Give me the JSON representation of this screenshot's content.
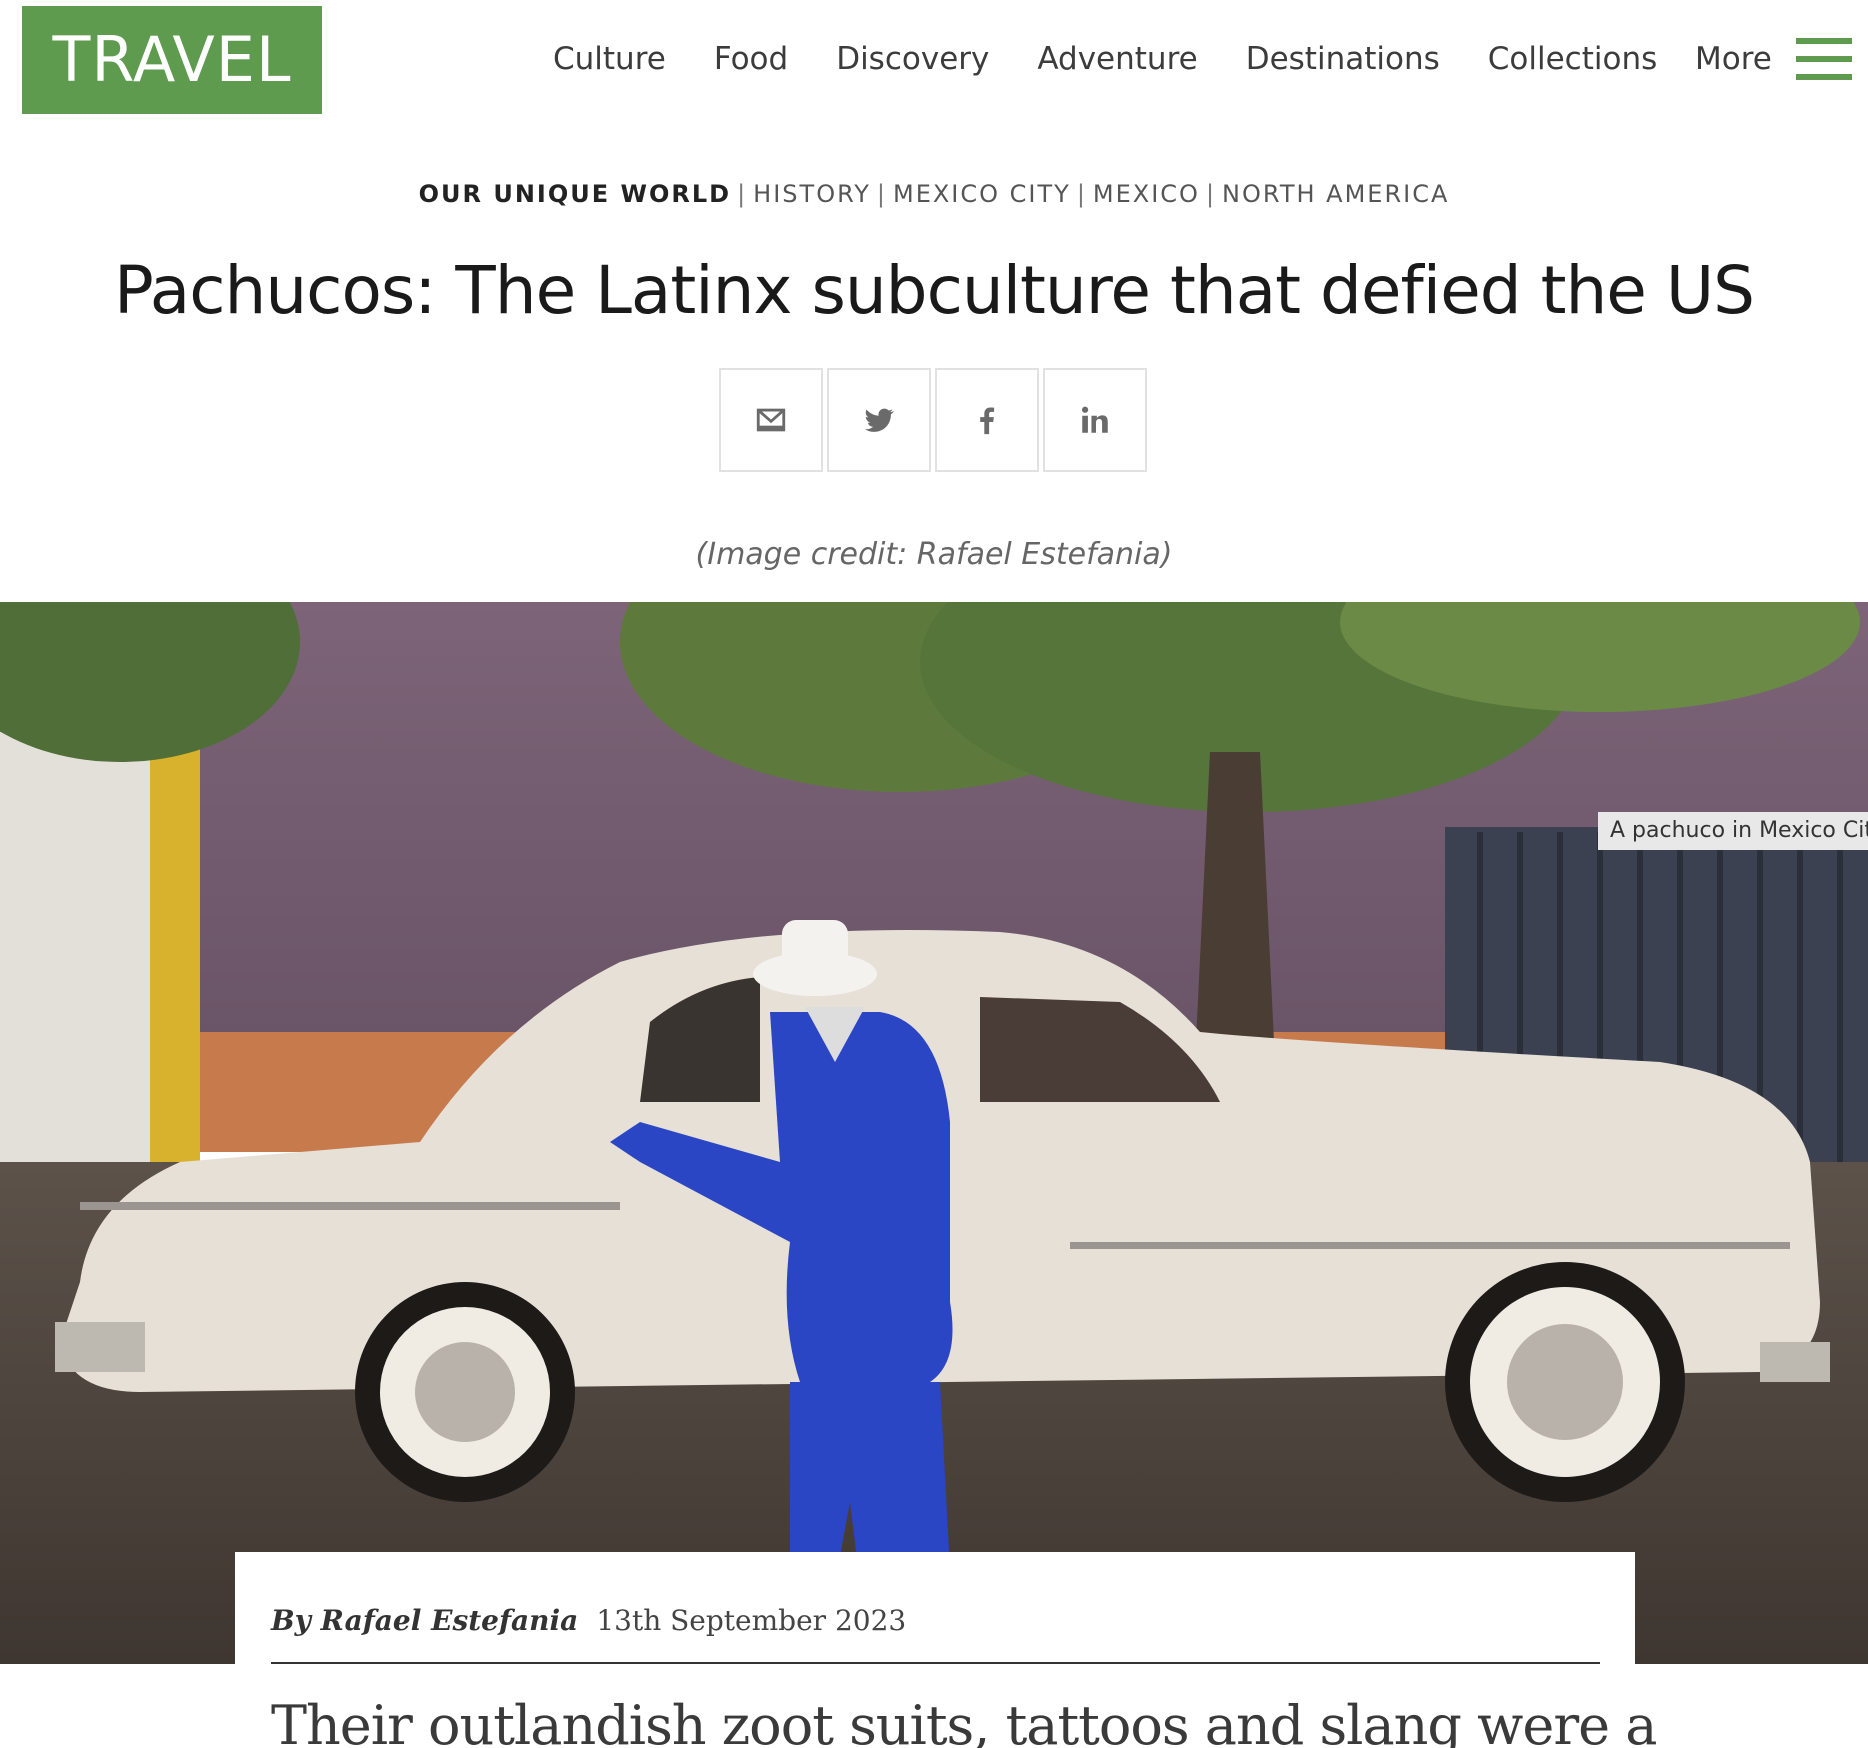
{
  "header": {
    "logo": "TRAVEL",
    "nav": [
      "Culture",
      "Food",
      "Discovery",
      "Adventure",
      "Destinations",
      "Collections"
    ],
    "more_label": "More",
    "accent_color": "#5e9b4f"
  },
  "tags": {
    "primary": "OUR UNIQUE WORLD",
    "items": [
      "HISTORY",
      "MEXICO CITY",
      "MEXICO",
      "NORTH AMERICA"
    ],
    "separator": "|"
  },
  "article": {
    "title": "Pachucos: The Latinx subculture that defied the US",
    "image_credit": "(Image credit: Rafael Estefania)",
    "image_caption": "A pachuco in Mexico City",
    "author": "By Rafael Estefania",
    "date": "13th September 2023",
    "lede": "Their outlandish zoot suits, tattoos and slang were a"
  },
  "share": {
    "icons": [
      "email-icon",
      "twitter-icon",
      "facebook-icon",
      "linkedin-icon"
    ]
  }
}
